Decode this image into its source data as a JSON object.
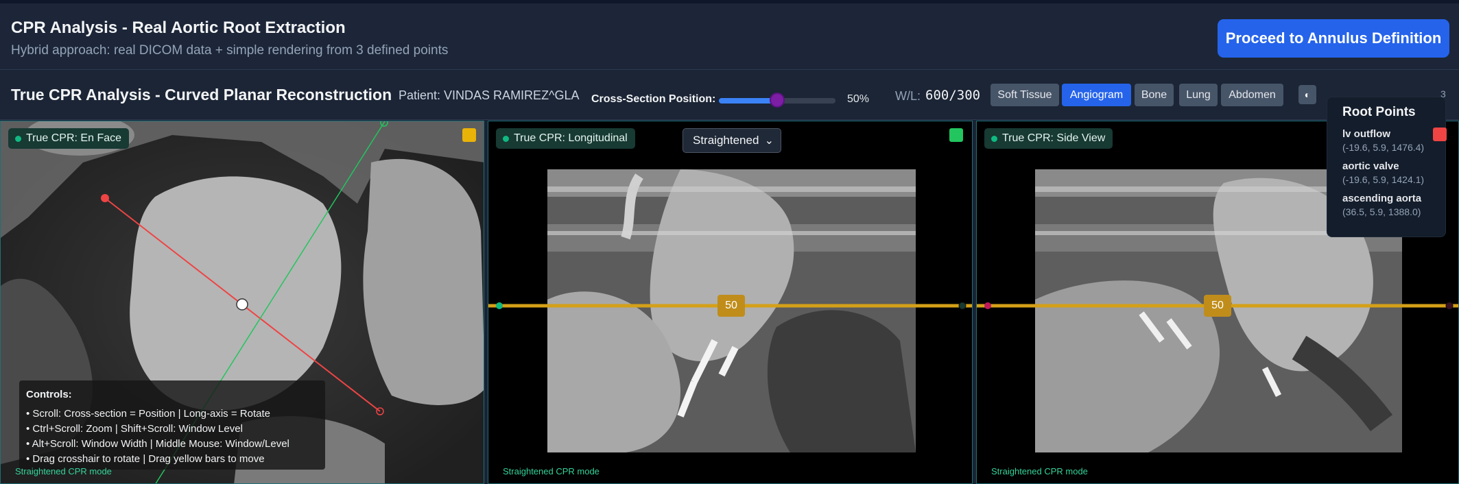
{
  "header": {
    "title": "CPR Analysis - Real Aortic Root Extraction",
    "subtitle": "Hybrid approach: real DICOM data + simple rendering from 3 defined points",
    "proceed_label": "Proceed to Annulus Definition"
  },
  "toolbar": {
    "title": "True CPR Analysis - Curved Planar Reconstruction",
    "patient": "Patient: VINDAS RAMIREZ^GLA",
    "cross_section_label": "Cross-Section Position:",
    "cross_section_value": "50%",
    "cross_section_fraction": 0.5,
    "wl_label": "W/L:",
    "wl_value": "600/300",
    "presets": [
      {
        "label": "Soft Tissue",
        "active": false
      },
      {
        "label": "Angiogram",
        "active": true
      },
      {
        "label": "Bone",
        "active": false
      },
      {
        "label": "Lung",
        "active": false
      },
      {
        "label": "Abdomen",
        "active": false
      }
    ],
    "theme_icon": "contrast-icon",
    "trailing_text": "3"
  },
  "viewports": {
    "en_face": {
      "label": "True CPR: En Face",
      "mode": "Straightened CPR mode",
      "corner_color": "#eab308"
    },
    "longitudinal": {
      "label": "True CPR: Longitudinal",
      "mode": "Straightened CPR mode",
      "view_select": "Straightened",
      "bar_value": "50",
      "corner_color": "#22c55e"
    },
    "side_view": {
      "label": "True CPR: Side View",
      "mode": "Straightened CPR mode",
      "bar_value": "50"
    }
  },
  "controls": {
    "title": "Controls:",
    "lines": [
      "• Scroll: Cross-section = Position | Long-axis = Rotate",
      "• Ctrl+Scroll: Zoom | Shift+Scroll: Window Level",
      "• Alt+Scroll: Window Width | Middle Mouse: Window/Level",
      "• Drag crosshair to rotate | Drag yellow bars to move"
    ]
  },
  "root_points": {
    "title": "Root Points",
    "items": [
      {
        "name": "lv outflow",
        "coord": "(-19.6, 5.9, 1476.4)",
        "color": "#ef4444"
      },
      {
        "name": "aortic valve",
        "coord": "(-19.6, 5.9, 1424.1)"
      },
      {
        "name": "ascending aorta",
        "coord": "(36.5, 5.9, 1388.0)"
      }
    ]
  },
  "colors": {
    "accent": "#2563eb",
    "crosshair_red": "#ef4444",
    "crosshair_green": "#22c55e",
    "bar_yellow": "#d4a017"
  }
}
